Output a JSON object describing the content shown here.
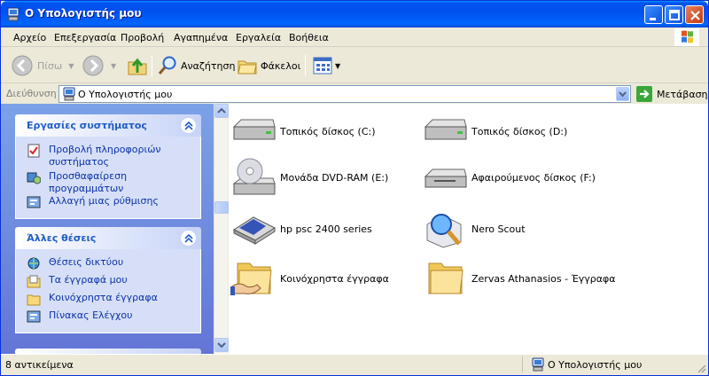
{
  "window": {
    "title": "Ο Υπολογιστής μου"
  },
  "menu": [
    "Αρχείο",
    "Επεξεργασία",
    "Προβολή",
    "Αγαπημένα",
    "Εργαλεία",
    "Βοήθεια"
  ],
  "toolbar": {
    "back": "Πίσω",
    "search": "Αναζήτηση",
    "folders": "Φάκελοι"
  },
  "address": {
    "label": "Διεύθυνση",
    "value": "Ο Υπολογιστής μου",
    "go": "Μετάβαση"
  },
  "left_panels": {
    "system_tasks": {
      "title": "Εργασίες συστήματος",
      "items": [
        "Προβολή πληροφοριών συστήματος",
        "Προσθαφαίρεση προγραμμάτων",
        "Αλλαγή μιας ρύθμισης"
      ]
    },
    "other_places": {
      "title": "Άλλες θέσεις",
      "items": [
        "Θέσεις δικτύου",
        "Τα έγγραφά μου",
        "Κοινόχρηστα έγγραφα",
        "Πίνακας Ελέγχου"
      ]
    }
  },
  "items": [
    {
      "label": "Τοπικός δίσκος (C:)",
      "icon": "hard-drive-icon"
    },
    {
      "label": "Τοπικός δίσκος (D:)",
      "icon": "hard-drive-icon"
    },
    {
      "label": "Μονάδα DVD-RAM (E:)",
      "icon": "dvd-drive-icon"
    },
    {
      "label": "Αφαιρούμενος δίσκος (F:)",
      "icon": "removable-disk-icon"
    },
    {
      "label": "hp psc 2400 series",
      "icon": "scanner-icon"
    },
    {
      "label": "Nero Scout",
      "icon": "nero-scout-icon"
    },
    {
      "label": "Κοινόχρηστα έγγραφα",
      "icon": "shared-folder-icon"
    },
    {
      "label": "Zervas Athanasios - Έγγραφα",
      "icon": "folder-icon"
    }
  ],
  "status": {
    "count": "8 αντικείμενα",
    "location": "Ο Υπολογιστής μου"
  }
}
